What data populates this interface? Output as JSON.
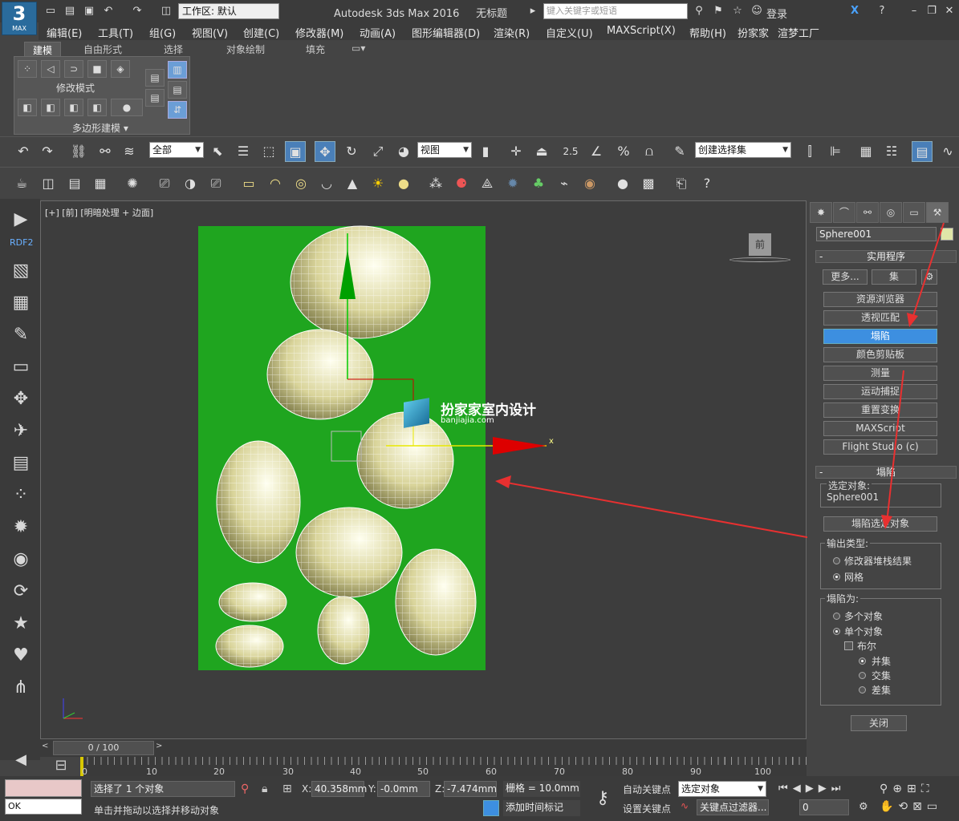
{
  "title_bar": {
    "logo_text": "3",
    "logo_sub": "MAX",
    "workspace": "工作区: 默认",
    "app_title": "Autodesk 3ds Max 2016",
    "file_title": "无标题",
    "search_placeholder": "键入关键字或短语",
    "login": "登录"
  },
  "menu": [
    "编辑(E)",
    "工具(T)",
    "组(G)",
    "视图(V)",
    "创建(C)",
    "修改器(M)",
    "动画(A)",
    "图形编辑器(D)",
    "渲染(R)",
    "自定义(U)",
    "MAXScript(X)",
    "帮助(H)",
    "扮家家",
    "渲梦工厂"
  ],
  "ribbon": {
    "tabs": [
      "建模",
      "自由形式",
      "选择",
      "对象绘制",
      "填充"
    ],
    "modify_mode": "修改模式",
    "poly_modeling": "多边形建模"
  },
  "toolbar": {
    "filter": "全部",
    "refcoord": "视图",
    "selection_set": "创建选择集",
    "snap_value": "2.5"
  },
  "left_bar": {
    "rdf_label": "RDF2"
  },
  "viewport": {
    "label": "[+] [前] [明暗处理 + 边面]",
    "viewcube": "前",
    "watermark_title": "扮家家室内设计",
    "watermark_url": "banjiajia.com",
    "axis_x": "x"
  },
  "command_panel": {
    "object_name": "Sphere001",
    "utilities_rollout": "实用程序",
    "more_button": "更多...",
    "sets_button": "集",
    "buttons": [
      "资源浏览器",
      "透视匹配",
      "塌陷",
      "颜色剪贴板",
      "测量",
      "运动捕捉",
      "重置变换",
      "MAXScript",
      "Flight Studio (c)"
    ],
    "selected_button": "塌陷",
    "collapse_rollout": "塌陷",
    "selected_objects_label": "选定对象:",
    "selected_object": "Sphere001",
    "collapse_selected": "塌陷选定对象",
    "output_type_label": "输出类型:",
    "output_options": [
      "修改器堆栈结果",
      "网格"
    ],
    "output_selected": 1,
    "collapse_to_label": "塌陷为:",
    "collapse_to_options": [
      "多个对象",
      "单个对象"
    ],
    "collapse_to_selected": 1,
    "boolean_label": "布尔",
    "boolean_options": [
      "并集",
      "交集",
      "差集"
    ],
    "boolean_selected": 0,
    "close_button": "关闭"
  },
  "timeline": {
    "frame_display": "0 / 100",
    "ticks": [
      "0",
      "10",
      "20",
      "30",
      "40",
      "50",
      "60",
      "70",
      "80",
      "90",
      "100"
    ]
  },
  "status": {
    "maxscript_out": "OK",
    "selection_msg": "选择了 1 个对象",
    "prompt": "单击并拖动以选择并移动对象",
    "x_label": "X:",
    "x_value": "40.358mm",
    "y_label": "Y:",
    "y_value": "-0.0mm",
    "z_label": "Z:",
    "z_value": "-7.474mm",
    "grid": "栅格 = 10.0mm",
    "add_time_tag": "添加时间标记",
    "auto_key": "自动关键点",
    "set_key": "设置关键点",
    "key_mode": "选定对象",
    "key_filters": "关键点过滤器...",
    "current_frame": "0"
  },
  "colors": {
    "accent": "#3d8fe0",
    "viewport_green": "#1fa51f",
    "arrow_red": "#e83030"
  }
}
